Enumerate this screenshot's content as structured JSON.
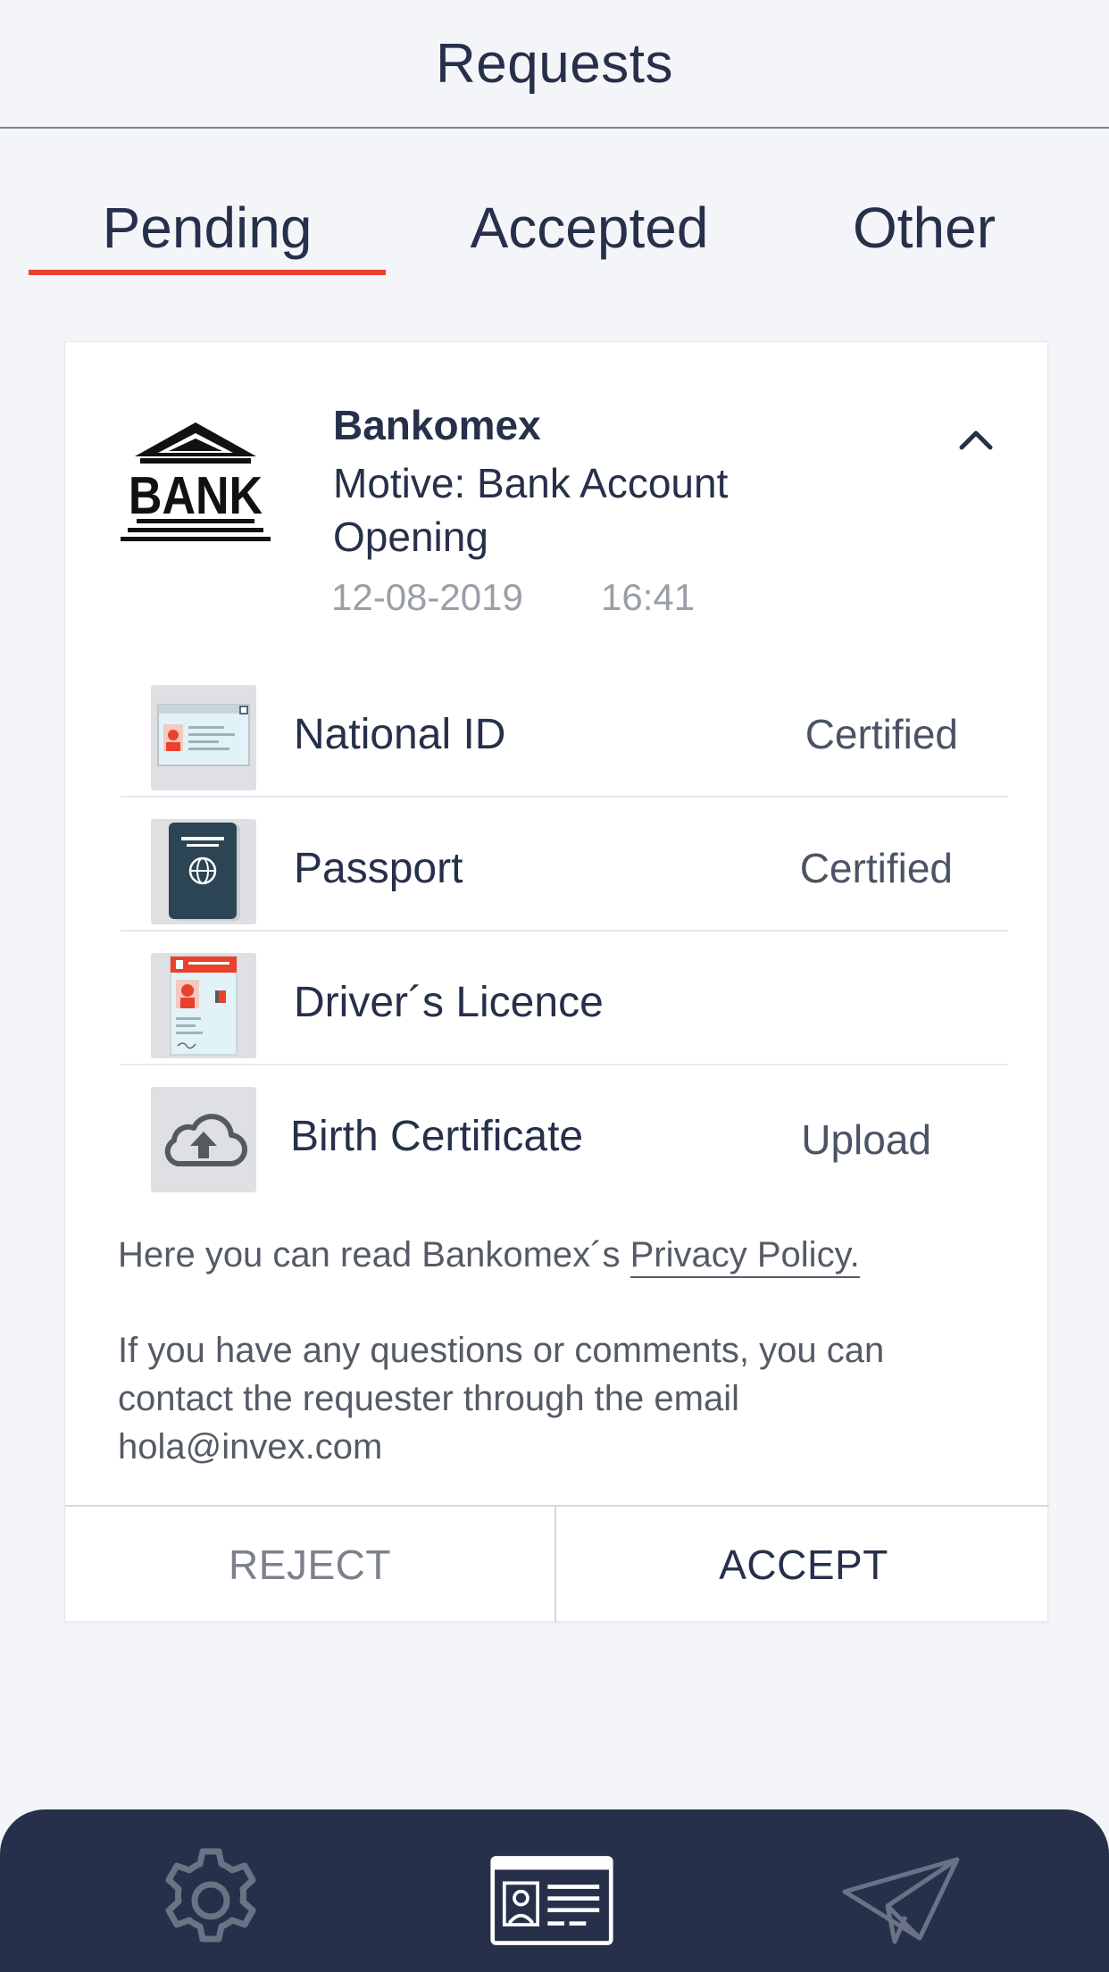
{
  "header": {
    "title": "Requests"
  },
  "tabs": [
    {
      "label": "Pending",
      "active": true
    },
    {
      "label": "Accepted",
      "active": false
    },
    {
      "label": "Other",
      "active": false
    }
  ],
  "request": {
    "logo_text": "BANK",
    "name": "Bankomex",
    "motive": "Motive: Bank Account Opening",
    "date": "12-08-2019",
    "time": "16:41",
    "documents": [
      {
        "name": "National ID",
        "status": "Certified",
        "icon": "national-id-icon"
      },
      {
        "name": "Passport",
        "status": "Certified",
        "icon": "passport-icon"
      },
      {
        "name": "Driver´s Licence",
        "status": "",
        "icon": "drivers-licence-icon"
      },
      {
        "name": "Birth Certificate",
        "status": "Upload",
        "icon": "cloud-upload-icon"
      }
    ],
    "privacy_text": "Here you can read Bankomex´s ",
    "privacy_link": "Privacy Policy.",
    "contact_text": "If you have any questions or comments, you can contact the requester through the email hola@invex.com",
    "reject_label": "REJECT",
    "accept_label": "ACCEPT"
  },
  "bottom_nav": [
    {
      "icon": "gear-icon"
    },
    {
      "icon": "id-card-icon",
      "active": true
    },
    {
      "icon": "paper-plane-icon"
    }
  ],
  "colors": {
    "accent": "#e9412b",
    "navy": "#27304a",
    "background": "#f3f5f9"
  }
}
